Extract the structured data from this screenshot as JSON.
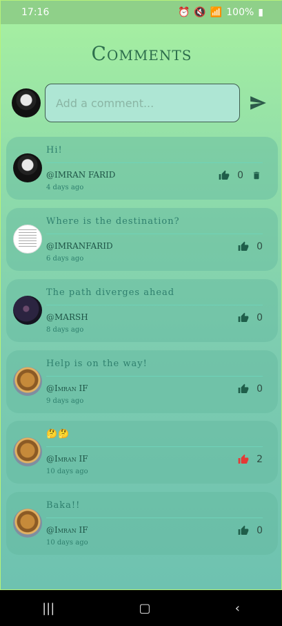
{
  "status": {
    "time": "17:16",
    "battery": "100%"
  },
  "page": {
    "title": "Comments"
  },
  "composer": {
    "placeholder": "Add a comment..."
  },
  "comments": [
    {
      "text": "Hi!",
      "user": "@IMRAN FARID",
      "time": "4 days ago",
      "likes": "0",
      "liked": false,
      "deletable": true,
      "avatar": "skull-logo"
    },
    {
      "text": "Where is the destination?",
      "user": "@IMRANFARID",
      "time": "6 days ago",
      "likes": "0",
      "liked": false,
      "deletable": false,
      "avatar": "document"
    },
    {
      "text": "The path diverges ahead",
      "user": "@MARSH",
      "time": "8 days ago",
      "likes": "0",
      "liked": false,
      "deletable": false,
      "avatar": "dark-scene"
    },
    {
      "text": "Help is on the way!",
      "user": "@Imran IF",
      "time": "9 days ago",
      "likes": "0",
      "liked": false,
      "deletable": false,
      "avatar": "cheetah"
    },
    {
      "text": "🤔🤔",
      "user": "@Imran IF",
      "time": "10 days ago",
      "likes": "2",
      "liked": true,
      "deletable": false,
      "avatar": "cheetah"
    },
    {
      "text": "Baka!!",
      "user": "@Imran IF",
      "time": "10 days ago",
      "likes": "0",
      "liked": false,
      "deletable": false,
      "avatar": "cheetah"
    }
  ],
  "colors": {
    "like_active": "#e53935",
    "like_inactive": "#1f5e4a",
    "accent": "#2d6e4c"
  }
}
